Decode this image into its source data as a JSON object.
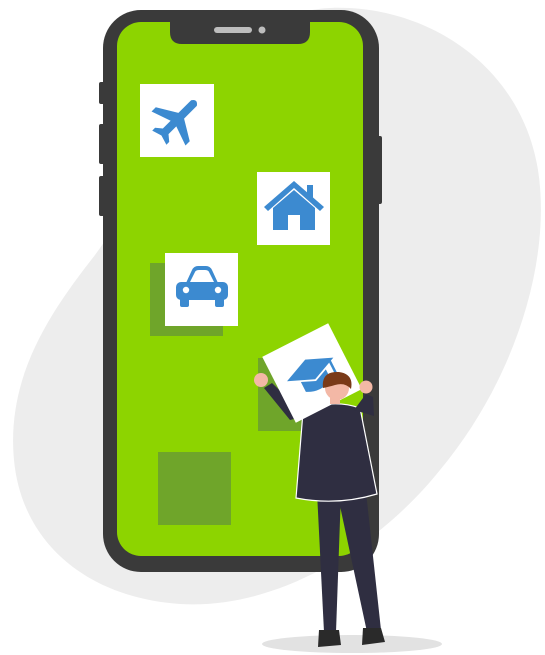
{
  "illustration": {
    "icons": [
      "airplane-icon",
      "house-icon",
      "car-icon",
      "graduation-cap-icon"
    ],
    "colors": {
      "screen": "#8dd400",
      "phone_frame": "#3a3a3a",
      "placeholder_tile": "#6fa52a",
      "icon_tile": "#ffffff",
      "icon": "#3c8ad0",
      "backdrop_blob": "#ededed",
      "suit": "#2f2e41",
      "skin": "#f3b8a6",
      "hair": "#7a3a18"
    }
  }
}
